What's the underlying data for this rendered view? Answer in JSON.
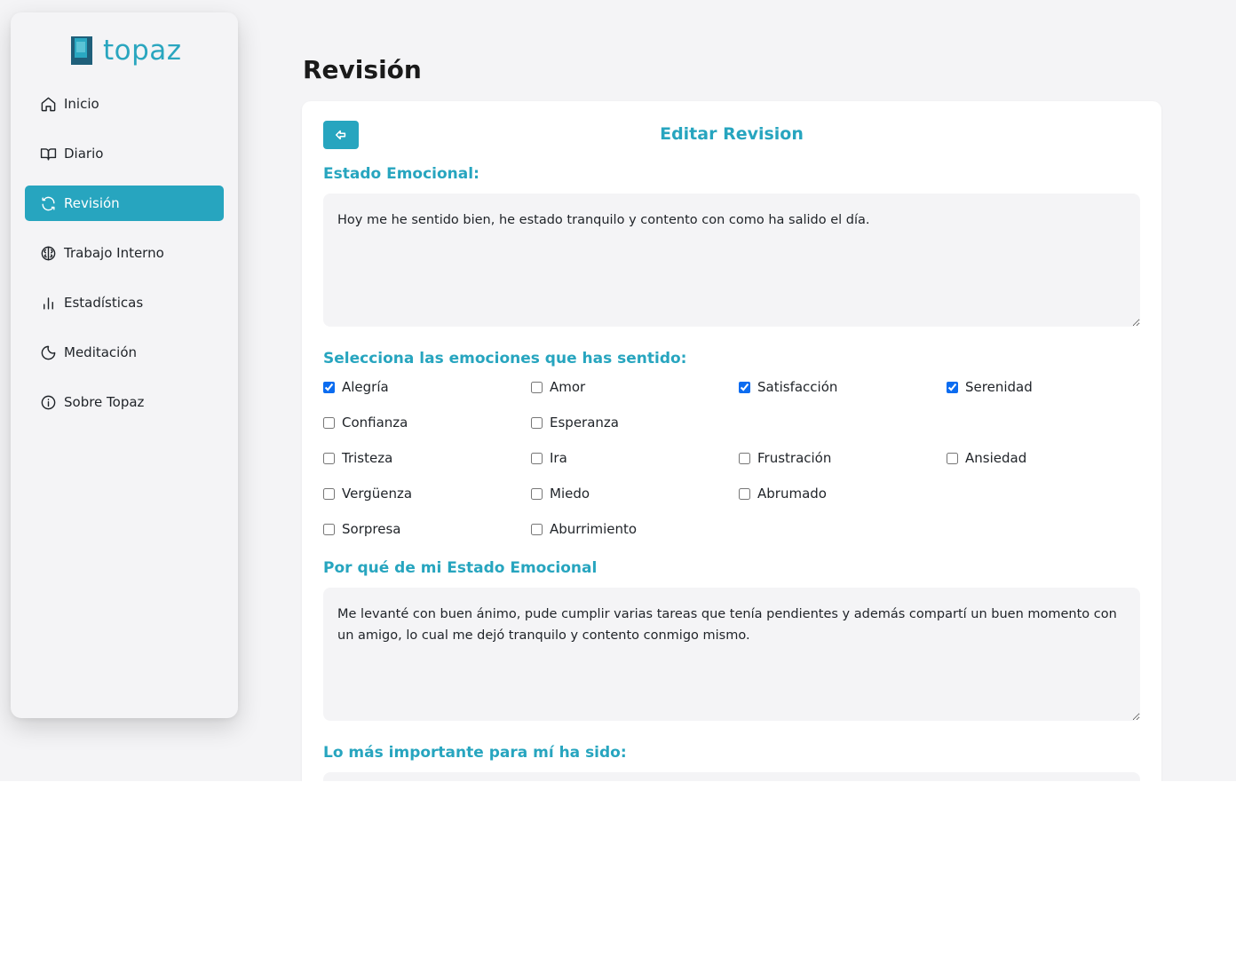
{
  "brand": {
    "name": "topaz"
  },
  "sidebar": {
    "items": [
      {
        "label": "Inicio",
        "icon": "home-icon",
        "active": false
      },
      {
        "label": "Diario",
        "icon": "book-icon",
        "active": false
      },
      {
        "label": "Revisión",
        "icon": "refresh-icon",
        "active": true
      },
      {
        "label": "Trabajo Interno",
        "icon": "brain-icon",
        "active": false
      },
      {
        "label": "Estadísticas",
        "icon": "bar-chart-icon",
        "active": false
      },
      {
        "label": "Meditación",
        "icon": "moon-icon",
        "active": false
      },
      {
        "label": "Sobre Topaz",
        "icon": "info-icon",
        "active": false
      }
    ]
  },
  "page": {
    "title": "Revisión"
  },
  "form": {
    "title": "Editar Revision",
    "back_icon": "back-arrow-icon",
    "estado_label": "Estado Emocional:",
    "estado_value": "Hoy me he sentido bien, he estado tranquilo y contento con como ha salido el día.",
    "emociones_label": "Selecciona las emociones que has sentido:",
    "emociones": [
      {
        "label": "Alegría",
        "checked": true
      },
      {
        "label": "Amor",
        "checked": false
      },
      {
        "label": "Satisfacción",
        "checked": true
      },
      {
        "label": "Serenidad",
        "checked": true
      },
      {
        "label": "Confianza",
        "checked": false
      },
      {
        "label": "Esperanza",
        "checked": false
      },
      {
        "label": "Tristeza",
        "checked": false
      },
      {
        "label": "Ira",
        "checked": false
      },
      {
        "label": "Frustración",
        "checked": false
      },
      {
        "label": "Ansiedad",
        "checked": false
      },
      {
        "label": "Vergüenza",
        "checked": false
      },
      {
        "label": "Miedo",
        "checked": false
      },
      {
        "label": "Abrumado",
        "checked": false
      },
      {
        "label": "Sorpresa",
        "checked": false
      },
      {
        "label": "Aburrimiento",
        "checked": false
      }
    ],
    "porque_label": "Por qué de mi Estado Emocional",
    "porque_value": "Me levanté con buen ánimo, pude cumplir varias tareas que tenía pendientes y además compartí un buen momento con un amigo, lo cual me dejó tranquilo y contento conmigo mismo.",
    "importante_label": "Lo más importante para mí ha sido:",
    "importante_value": ""
  },
  "colors": {
    "accent": "#27a5bf",
    "background": "#f4f4f6",
    "checkbox": "#0b6cf0"
  }
}
